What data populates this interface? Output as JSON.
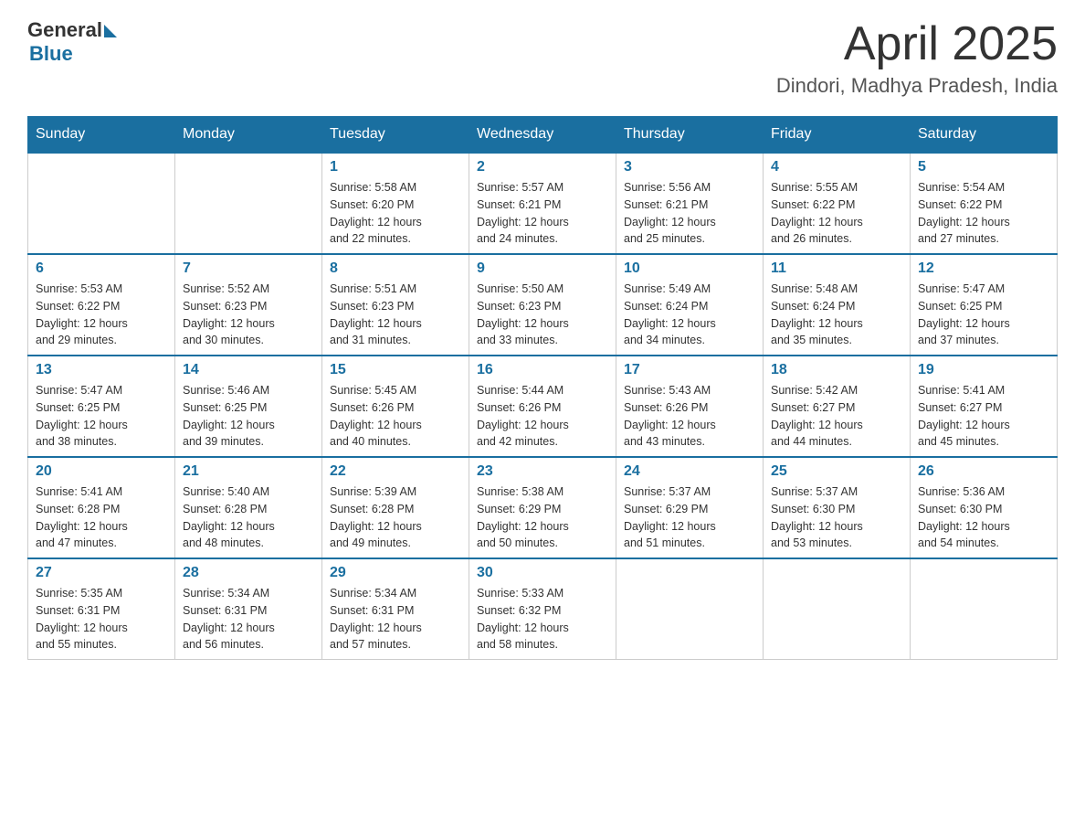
{
  "header": {
    "logo_general": "General",
    "logo_blue": "Blue",
    "month": "April 2025",
    "location": "Dindori, Madhya Pradesh, India"
  },
  "weekdays": [
    "Sunday",
    "Monday",
    "Tuesday",
    "Wednesday",
    "Thursday",
    "Friday",
    "Saturday"
  ],
  "weeks": [
    [
      {
        "day": "",
        "info": ""
      },
      {
        "day": "",
        "info": ""
      },
      {
        "day": "1",
        "info": "Sunrise: 5:58 AM\nSunset: 6:20 PM\nDaylight: 12 hours\nand 22 minutes."
      },
      {
        "day": "2",
        "info": "Sunrise: 5:57 AM\nSunset: 6:21 PM\nDaylight: 12 hours\nand 24 minutes."
      },
      {
        "day": "3",
        "info": "Sunrise: 5:56 AM\nSunset: 6:21 PM\nDaylight: 12 hours\nand 25 minutes."
      },
      {
        "day": "4",
        "info": "Sunrise: 5:55 AM\nSunset: 6:22 PM\nDaylight: 12 hours\nand 26 minutes."
      },
      {
        "day": "5",
        "info": "Sunrise: 5:54 AM\nSunset: 6:22 PM\nDaylight: 12 hours\nand 27 minutes."
      }
    ],
    [
      {
        "day": "6",
        "info": "Sunrise: 5:53 AM\nSunset: 6:22 PM\nDaylight: 12 hours\nand 29 minutes."
      },
      {
        "day": "7",
        "info": "Sunrise: 5:52 AM\nSunset: 6:23 PM\nDaylight: 12 hours\nand 30 minutes."
      },
      {
        "day": "8",
        "info": "Sunrise: 5:51 AM\nSunset: 6:23 PM\nDaylight: 12 hours\nand 31 minutes."
      },
      {
        "day": "9",
        "info": "Sunrise: 5:50 AM\nSunset: 6:23 PM\nDaylight: 12 hours\nand 33 minutes."
      },
      {
        "day": "10",
        "info": "Sunrise: 5:49 AM\nSunset: 6:24 PM\nDaylight: 12 hours\nand 34 minutes."
      },
      {
        "day": "11",
        "info": "Sunrise: 5:48 AM\nSunset: 6:24 PM\nDaylight: 12 hours\nand 35 minutes."
      },
      {
        "day": "12",
        "info": "Sunrise: 5:47 AM\nSunset: 6:25 PM\nDaylight: 12 hours\nand 37 minutes."
      }
    ],
    [
      {
        "day": "13",
        "info": "Sunrise: 5:47 AM\nSunset: 6:25 PM\nDaylight: 12 hours\nand 38 minutes."
      },
      {
        "day": "14",
        "info": "Sunrise: 5:46 AM\nSunset: 6:25 PM\nDaylight: 12 hours\nand 39 minutes."
      },
      {
        "day": "15",
        "info": "Sunrise: 5:45 AM\nSunset: 6:26 PM\nDaylight: 12 hours\nand 40 minutes."
      },
      {
        "day": "16",
        "info": "Sunrise: 5:44 AM\nSunset: 6:26 PM\nDaylight: 12 hours\nand 42 minutes."
      },
      {
        "day": "17",
        "info": "Sunrise: 5:43 AM\nSunset: 6:26 PM\nDaylight: 12 hours\nand 43 minutes."
      },
      {
        "day": "18",
        "info": "Sunrise: 5:42 AM\nSunset: 6:27 PM\nDaylight: 12 hours\nand 44 minutes."
      },
      {
        "day": "19",
        "info": "Sunrise: 5:41 AM\nSunset: 6:27 PM\nDaylight: 12 hours\nand 45 minutes."
      }
    ],
    [
      {
        "day": "20",
        "info": "Sunrise: 5:41 AM\nSunset: 6:28 PM\nDaylight: 12 hours\nand 47 minutes."
      },
      {
        "day": "21",
        "info": "Sunrise: 5:40 AM\nSunset: 6:28 PM\nDaylight: 12 hours\nand 48 minutes."
      },
      {
        "day": "22",
        "info": "Sunrise: 5:39 AM\nSunset: 6:28 PM\nDaylight: 12 hours\nand 49 minutes."
      },
      {
        "day": "23",
        "info": "Sunrise: 5:38 AM\nSunset: 6:29 PM\nDaylight: 12 hours\nand 50 minutes."
      },
      {
        "day": "24",
        "info": "Sunrise: 5:37 AM\nSunset: 6:29 PM\nDaylight: 12 hours\nand 51 minutes."
      },
      {
        "day": "25",
        "info": "Sunrise: 5:37 AM\nSunset: 6:30 PM\nDaylight: 12 hours\nand 53 minutes."
      },
      {
        "day": "26",
        "info": "Sunrise: 5:36 AM\nSunset: 6:30 PM\nDaylight: 12 hours\nand 54 minutes."
      }
    ],
    [
      {
        "day": "27",
        "info": "Sunrise: 5:35 AM\nSunset: 6:31 PM\nDaylight: 12 hours\nand 55 minutes."
      },
      {
        "day": "28",
        "info": "Sunrise: 5:34 AM\nSunset: 6:31 PM\nDaylight: 12 hours\nand 56 minutes."
      },
      {
        "day": "29",
        "info": "Sunrise: 5:34 AM\nSunset: 6:31 PM\nDaylight: 12 hours\nand 57 minutes."
      },
      {
        "day": "30",
        "info": "Sunrise: 5:33 AM\nSunset: 6:32 PM\nDaylight: 12 hours\nand 58 minutes."
      },
      {
        "day": "",
        "info": ""
      },
      {
        "day": "",
        "info": ""
      },
      {
        "day": "",
        "info": ""
      }
    ]
  ]
}
